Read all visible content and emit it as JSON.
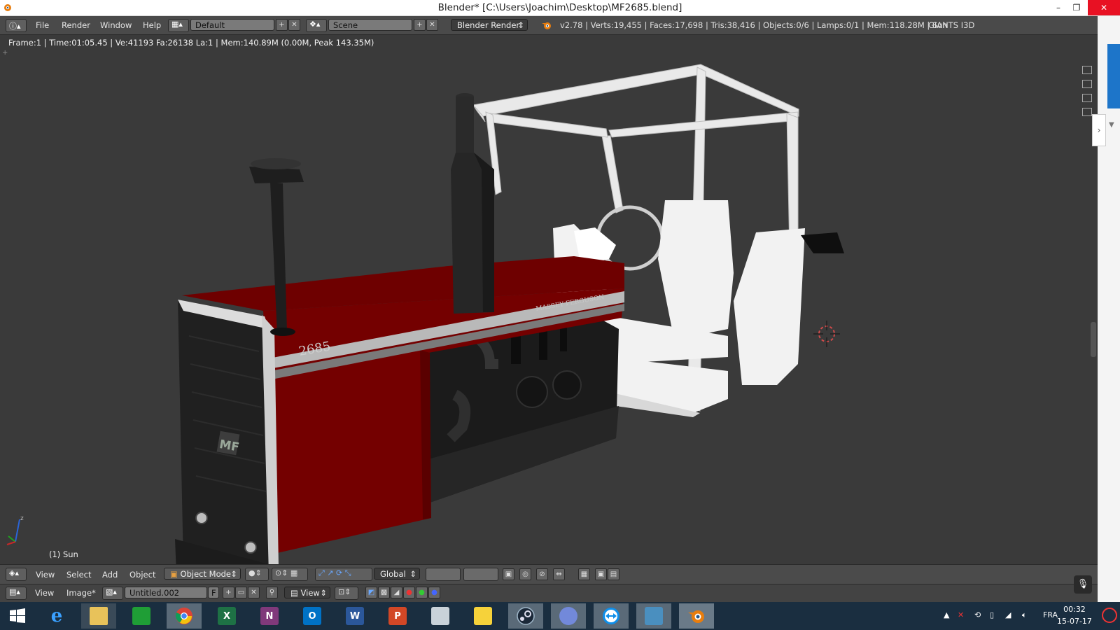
{
  "window": {
    "title": "Blender* [C:\\Users\\Joachim\\Desktop\\MF2685.blend]",
    "minimize": "–",
    "restore": "❐",
    "close": "✕"
  },
  "infobar": {
    "menus": [
      "File",
      "Render",
      "Window",
      "Help"
    ],
    "layout": "Default",
    "scene": "Scene",
    "engine": "Blender Render",
    "stats": "v2.78 | Verts:19,455 | Faces:17,698 | Tris:38,416 | Objects:0/6 | Lamps:0/1 | Mem:118.28M | Sun",
    "addon": "GIANTS I3D"
  },
  "viewport": {
    "info": "Frame:1 | Time:01:05.45 | Ve:41193 Fa:26138 La:1 | Mem:140.89M (0.00M, Peak 143.35M)",
    "object_label": "(1) Sun",
    "decal_model": "2685",
    "decal_brand": "MASSEY FERGUSON",
    "decal_logo": "MF",
    "axis_z": "z"
  },
  "view3d_header": {
    "menus": [
      "View",
      "Select",
      "Add",
      "Object"
    ],
    "mode": "Object Mode",
    "orientation": "Global"
  },
  "image_header": {
    "menus": [
      "View",
      "Image*"
    ],
    "image_name": "Untitled.002",
    "fake_user": "F",
    "view_mode": "View"
  },
  "taskbar": {
    "apps": [
      {
        "name": "start",
        "label": ""
      },
      {
        "name": "internet-explorer",
        "label": "e"
      },
      {
        "name": "file-explorer",
        "label": ""
      },
      {
        "name": "store",
        "label": ""
      },
      {
        "name": "chrome",
        "label": ""
      },
      {
        "name": "excel",
        "label": "X"
      },
      {
        "name": "onenote",
        "label": "N"
      },
      {
        "name": "outlook",
        "label": "O"
      },
      {
        "name": "word",
        "label": "W"
      },
      {
        "name": "powerpoint",
        "label": "P"
      },
      {
        "name": "photos",
        "label": ""
      },
      {
        "name": "sticky",
        "label": ""
      },
      {
        "name": "steam",
        "label": ""
      },
      {
        "name": "discord",
        "label": ""
      },
      {
        "name": "teamviewer",
        "label": ""
      },
      {
        "name": "image-viewer",
        "label": ""
      },
      {
        "name": "blender",
        "label": ""
      }
    ],
    "language": "FRA",
    "time": "00:32",
    "date": "15-07-17"
  },
  "colors": {
    "tractor_red": "#7a0000",
    "blender_orange": "#e87d0d",
    "taskbar": "#1a2e40"
  }
}
